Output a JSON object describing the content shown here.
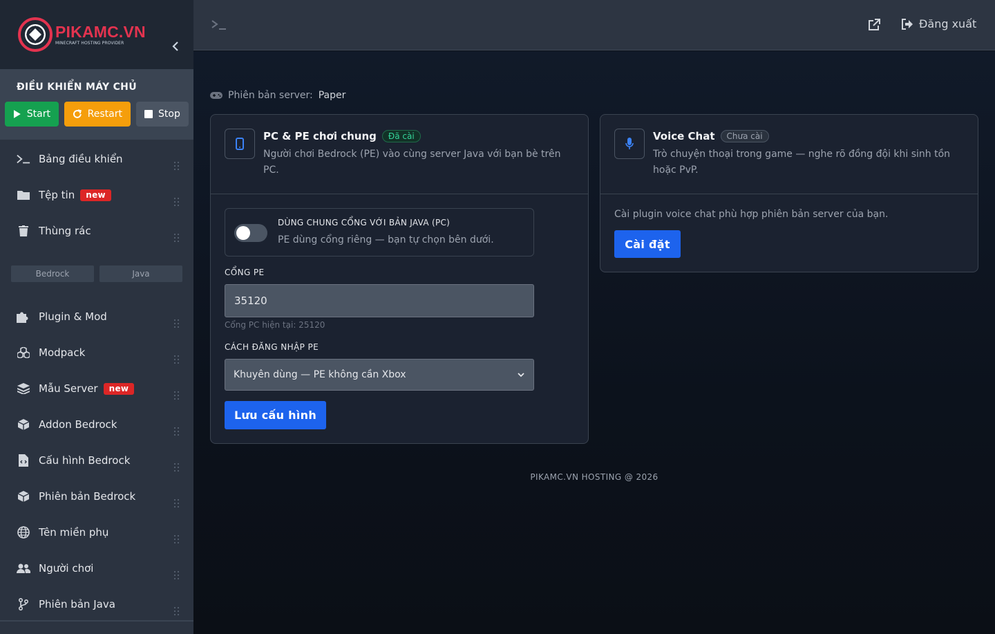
{
  "brand": {
    "name": "PIKAMC.VN",
    "tagline": "MINECRAFT HOSTING PROVIDER",
    "accent": "#e3334f"
  },
  "controls": {
    "title": "ĐIỀU KHIỂN MÁY CHỦ",
    "start": "Start",
    "restart": "Restart",
    "stop": "Stop"
  },
  "nav": {
    "dashboard": "Bảng điều khiển",
    "files": "Tệp tin",
    "files_badge": "new",
    "trash": "Thùng rác",
    "tab_bedrock": "Bedrock",
    "tab_java": "Java",
    "plugins": "Plugin & Mod",
    "modpack": "Modpack",
    "templates": "Mẫu Server",
    "templates_badge": "new",
    "addon": "Addon Bedrock",
    "bedrock_config": "Cấu hình Bedrock",
    "bedrock_version": "Phiên bản Bedrock",
    "subdomain": "Tên miền phụ",
    "players": "Người chơi",
    "java_version": "Phiên bản Java"
  },
  "header": {
    "logout": "Đăng xuất"
  },
  "server": {
    "version_label": "Phiên bản server:",
    "version_value": "Paper"
  },
  "crossplay": {
    "title": "PC & PE chơi chung",
    "status": "Đã cài",
    "description": "Người chơi Bedrock (PE) vào cùng server Java với bạn bè trên PC.",
    "toggle_title": "DÙNG CHUNG CỔNG VỚI BẢN JAVA (PC)",
    "toggle_desc": "PE dùng cổng riêng — bạn tự chọn bên dưới.",
    "toggle_on": false,
    "port_label": "CỔNG PE",
    "port_value": "35120",
    "port_hint": "Cổng PC hiện tại: 25120",
    "login_label": "CÁCH ĐĂNG NHẬP PE",
    "login_selected": "Khuyên dùng — PE không cần Xbox",
    "save": "Lưu cấu hình"
  },
  "voicechat": {
    "title": "Voice Chat",
    "status": "Chưa cài",
    "description": "Trò chuyện thoại trong game — nghe rõ đồng đội khi sinh tồn hoặc PvP.",
    "body": "Cài plugin voice chat phù hợp phiên bản server của bạn.",
    "install": "Cài đặt"
  },
  "footer": "PIKAMC.VN HOSTING @ 2026",
  "colors": {
    "start": "#15a150",
    "restart": "#f59e0b",
    "stop": "#4b5563",
    "primary": "#1d63ed",
    "badge": "#dc2626",
    "installed": "#34d399"
  }
}
